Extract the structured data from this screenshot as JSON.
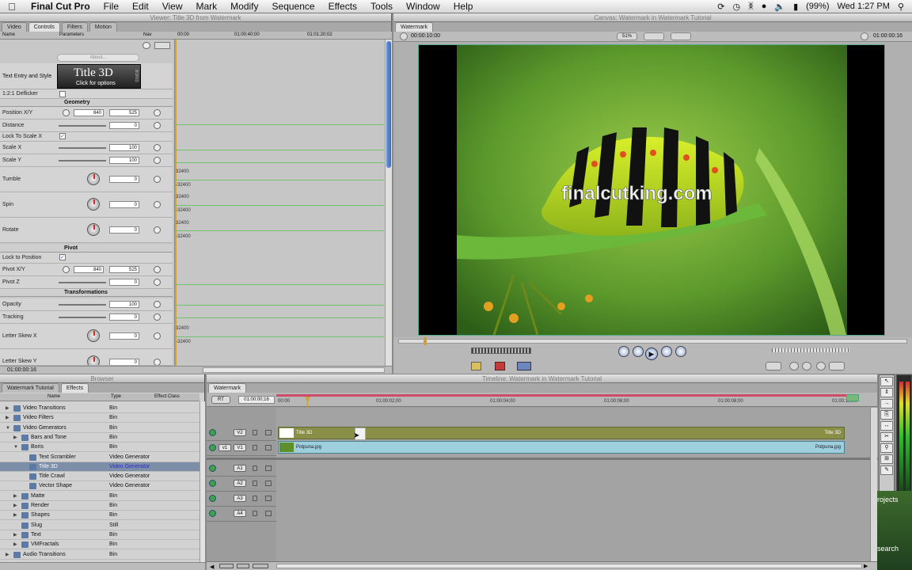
{
  "menubar": {
    "app": "Final Cut Pro",
    "items": [
      "File",
      "Edit",
      "View",
      "Mark",
      "Modify",
      "Sequence",
      "Effects",
      "Tools",
      "Window",
      "Help"
    ],
    "battery": "(99%)",
    "clock": "Wed 1:27 PM"
  },
  "viewer": {
    "window_title": "Viewer: Title 3D from Watermark",
    "tabs": [
      "Video",
      "Controls",
      "Filters",
      "Motion"
    ],
    "columns": {
      "name": "Name",
      "parameters": "Parameters",
      "nav": "Nav"
    },
    "ruler": [
      "00:00",
      "01:00:40;00",
      "01:01:20;02"
    ],
    "about_btn": "About...",
    "title_tile": "Title 3D",
    "title_tile_sub": "Click for options",
    "title_tile_side": "BORIS",
    "timecode": "01:00:00:16",
    "rows": [
      {
        "label": "Text Entry and Style"
      },
      {
        "label": "1:2:1 Deflicker"
      },
      {
        "section": "Geometry"
      },
      {
        "label": "Position X/Y",
        "x": "840",
        "y": "525"
      },
      {
        "label": "Distance",
        "value": "0"
      },
      {
        "label": "Lock To Scale X"
      },
      {
        "label": "Scale X",
        "value": "100"
      },
      {
        "label": "Scale Y",
        "value": "100"
      },
      {
        "label": "Tumble",
        "value": "0"
      },
      {
        "label": "Spin",
        "value": "0"
      },
      {
        "label": "Rotate",
        "value": "0"
      },
      {
        "section": "Pivot"
      },
      {
        "label": "Lock to Position"
      },
      {
        "label": "Pivot X/Y",
        "x": "840",
        "y": "525"
      },
      {
        "label": "Pivot Z",
        "value": "0"
      },
      {
        "section": "Transformations"
      },
      {
        "label": "Opacity",
        "value": "100"
      },
      {
        "label": "Tracking",
        "value": "0"
      },
      {
        "label": "Letter Skew X",
        "value": "0"
      },
      {
        "label": "Letter Skew Y",
        "value": "0"
      }
    ],
    "keyframe_values": [
      "32400",
      "-32400",
      "32400",
      "-32400",
      "32400",
      "-32400",
      "32400",
      "-32400"
    ]
  },
  "canvas": {
    "window_title": "Canvas: Watermark in Watermark Tutorial",
    "tab": "Watermark",
    "timecode_left": "00:00:10:00",
    "zoom": "51%",
    "timecode_right": "01:00:00:16",
    "watermark_text": "finalcutking.com"
  },
  "browser": {
    "window_title": "Browser",
    "tabs": [
      "Watermark Tutorial",
      "Effects"
    ],
    "columns": {
      "name": "Name",
      "type": "Type",
      "effect_class": "Effect Class"
    },
    "rows": [
      {
        "name": "Video Transitions",
        "type": "Bin",
        "tri": "▶"
      },
      {
        "name": "Video Filters",
        "type": "Bin",
        "tri": "▶"
      },
      {
        "name": "Video Generators",
        "type": "Bin",
        "tri": "▼"
      },
      {
        "name": "Bars and Tone",
        "type": "Bin",
        "tri": "▶"
      },
      {
        "name": "Boris",
        "type": "Bin",
        "tri": "▼"
      },
      {
        "name": "Text Scrambler",
        "type": "Video Generator",
        "tri": ""
      },
      {
        "name": "Title 3D",
        "type": "Video Generator",
        "tri": "",
        "selected": true
      },
      {
        "name": "Title Crawl",
        "type": "Video Generator",
        "tri": ""
      },
      {
        "name": "Vector Shape",
        "type": "Video Generator",
        "tri": ""
      },
      {
        "name": "Matte",
        "type": "Bin",
        "tri": "▶"
      },
      {
        "name": "Render",
        "type": "Bin",
        "tri": "▶"
      },
      {
        "name": "Shapes",
        "type": "Bin",
        "tri": "▶"
      },
      {
        "name": "Slug",
        "type": "Still",
        "tri": ""
      },
      {
        "name": "Text",
        "type": "Bin",
        "tri": "▶"
      },
      {
        "name": "VMFractals",
        "type": "Bin",
        "tri": "▶"
      },
      {
        "name": "Audio Transitions",
        "type": "Bin",
        "tri": "▶"
      }
    ]
  },
  "timeline": {
    "window_title": "Timeline: Watermark in Watermark Tutorial",
    "tab": "Watermark",
    "rt": "RT",
    "timecode": "01:00:00;16",
    "ruler": [
      "00:00",
      "01:00:02;00",
      "01:00:04;00",
      "01:00:06;00",
      "01:00:08;00",
      "01:00:10;00"
    ],
    "video_tracks": [
      {
        "dest": "",
        "label": "V2",
        "clip": "Title 3D",
        "clip_end": "Title 3D"
      },
      {
        "dest": "v1",
        "label": "V1",
        "clip": "Potpuna.jpg",
        "clip_end": "Potpuna.jpg"
      }
    ],
    "audio_tracks": [
      "A1",
      "A2",
      "A3",
      "A4"
    ]
  },
  "desktop": {
    "label_1": "rojects",
    "label_2": "search"
  },
  "colors": {
    "title_clip": "#8a8f48",
    "image_clip": "#9ecfdc",
    "playhead": "#d1a23a",
    "keyframe_line": "#6fc36f",
    "selection": "#7d8ea9"
  }
}
